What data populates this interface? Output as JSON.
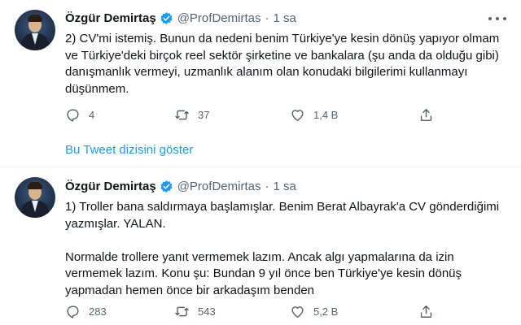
{
  "tweets": [
    {
      "name": "Özgür Demirtaş",
      "handle": "@ProfDemirtas",
      "dot": "·",
      "time": "1 sa",
      "text": "2) CV'mi istemiş. Bunun da nedeni benim Türkiye'ye kesin dönüş yapıyor olmam ve Türkiye'deki birçok reel sektör şirketine ve  bankalara (şu anda da olduğu gibi) danışmanlık vermeyi, uzmanlık alanım olan konudaki bilgilerimi kullanmayı düşünmem.",
      "replies": "4",
      "retweets": "37",
      "likes": "1,4 B"
    },
    {
      "name": "Özgür Demirtaş",
      "handle": "@ProfDemirtas",
      "dot": "·",
      "time": "1 sa",
      "text": "1) Troller bana saldırmaya başlamışlar. Benim Berat Albayrak'a CV gönderdiğimi yazmışlar. YALAN.\n\nNormalde trollere yanıt vermemek lazım. Ancak algı yapmalarına da izin vermemek lazım. Konu şu: Bundan 9 yıl önce ben Türkiye'ye kesin dönüş yapmadan hemen önce bir arkadaşım benden",
      "replies": "283",
      "retweets": "543",
      "likes": "5,2 B"
    }
  ],
  "thread_link": "Bu Tweet dizisini göster",
  "colors": {
    "accent": "#1d9bf0",
    "text": "#0f1419",
    "muted": "#536471",
    "divider": "#eff3f4"
  },
  "icons": {
    "verified": "verified-badge-icon",
    "more": "more-icon",
    "reply": "reply-icon",
    "retweet": "retweet-icon",
    "like": "heart-icon",
    "share": "share-icon"
  }
}
